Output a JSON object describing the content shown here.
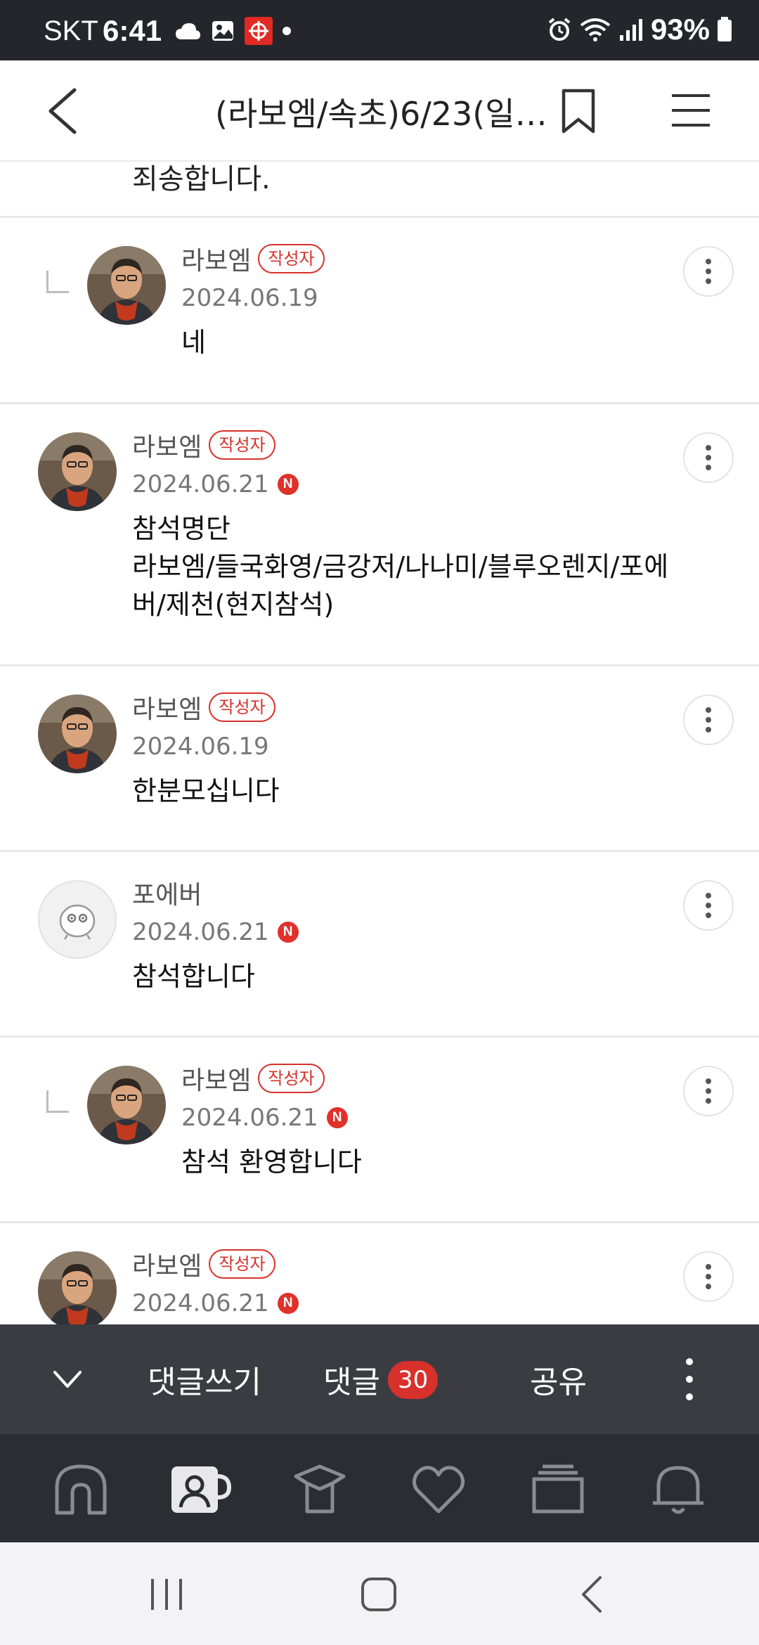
{
  "status_bar": {
    "carrier": "SKT",
    "time": "6:41",
    "battery": "93%"
  },
  "header": {
    "title": "(라보엠/속초)6/23(일)..."
  },
  "partial_comment": {
    "text": "죄송합니다."
  },
  "comments": [
    {
      "author": "라보엠",
      "badge": "작성자",
      "date": "2024.06.19",
      "is_new": false,
      "text": "네",
      "is_reply": true
    },
    {
      "author": "라보엠",
      "badge": "작성자",
      "date": "2024.06.21",
      "is_new": true,
      "new_label": "N",
      "text_lines": [
        "참석명단",
        "라보엠/들국화영/금강저/나나미/블루오렌지/포에",
        "버/제천(현지참석)"
      ],
      "is_reply": false
    },
    {
      "author": "라보엠",
      "badge": "작성자",
      "date": "2024.06.19",
      "is_new": false,
      "text": "한분모십니다",
      "is_reply": false
    },
    {
      "author": "포에버",
      "date": "2024.06.21",
      "is_new": true,
      "new_label": "N",
      "text": "참석합니다",
      "is_reply": false
    },
    {
      "author": "라보엠",
      "badge": "작성자",
      "date": "2024.06.21",
      "is_new": true,
      "new_label": "N",
      "text": "참석 환영합니다",
      "is_reply": true
    },
    {
      "author": "라보엠",
      "badge": "작성자",
      "date": "2024.06.21",
      "is_new": true,
      "new_label": "N",
      "is_reply": false
    }
  ],
  "comment_bar": {
    "write_label": "댓글쓰기",
    "comments_label": "댓글",
    "comment_count": "30",
    "share_label": "공유"
  },
  "bottom_nav": {
    "items": [
      "home-icon",
      "my-cafe-icon",
      "shopping-icon",
      "favorites-icon",
      "boards-icon",
      "notifications-icon"
    ]
  },
  "colors": {
    "accent_red": "#d8312b",
    "status_bar_bg": "#24262b",
    "comment_bar_bg": "#3a3c42",
    "nav_bg": "#2b2d33"
  }
}
